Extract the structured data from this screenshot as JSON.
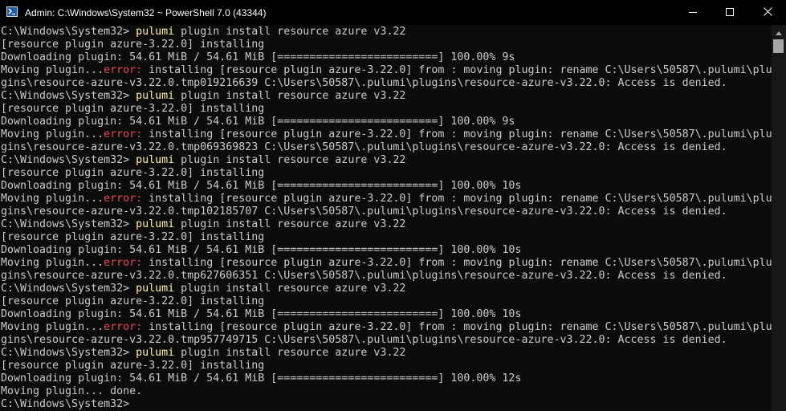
{
  "window": {
    "title": "Admin: C:\\Windows\\System32 ~ PowerShell 7.0 (43344)"
  },
  "colors": {
    "background": "#0c0c0c",
    "text": "#cccccc",
    "command": "#f9f1a5",
    "error": "#e74856"
  },
  "icons": {
    "app": "powershell-icon",
    "minimize": "minimize-icon",
    "maximize": "maximize-icon",
    "close": "close-icon",
    "scroll_up": "scroll-up-arrow-icon"
  },
  "terminal": {
    "lines": [
      [
        {
          "t": "C:\\Windows\\System32> "
        },
        {
          "t": "pulumi",
          "c": "cmd"
        },
        {
          "t": " plugin install resource azure v3.22"
        }
      ],
      [
        {
          "t": "[resource plugin azure-3.22.0] installing"
        }
      ],
      [
        {
          "t": "Downloading plugin: 54.61 MiB / 54.61 MiB [=========================] 100.00% 9s"
        }
      ],
      [
        {
          "t": "Moving plugin..."
        },
        {
          "t": "error:",
          "c": "err"
        },
        {
          "t": " installing [resource plugin azure-3.22.0] from : moving plugin: rename C:\\Users\\50587\\.pulumi\\plu"
        }
      ],
      [
        {
          "t": "gins\\resource-azure-v3.22.0.tmp019216639 C:\\Users\\50587\\.pulumi\\plugins\\resource-azure-v3.22.0: Access is denied."
        }
      ],
      [
        {
          "t": "C:\\Windows\\System32> "
        },
        {
          "t": "pulumi",
          "c": "cmd"
        },
        {
          "t": " plugin install resource azure v3.22"
        }
      ],
      [
        {
          "t": "[resource plugin azure-3.22.0] installing"
        }
      ],
      [
        {
          "t": "Downloading plugin: 54.61 MiB / 54.61 MiB [=========================] 100.00% 9s"
        }
      ],
      [
        {
          "t": "Moving plugin..."
        },
        {
          "t": "error:",
          "c": "err"
        },
        {
          "t": " installing [resource plugin azure-3.22.0] from : moving plugin: rename C:\\Users\\50587\\.pulumi\\plu"
        }
      ],
      [
        {
          "t": "gins\\resource-azure-v3.22.0.tmp069369823 C:\\Users\\50587\\.pulumi\\plugins\\resource-azure-v3.22.0: Access is denied."
        }
      ],
      [
        {
          "t": "C:\\Windows\\System32> "
        },
        {
          "t": "pulumi",
          "c": "cmd"
        },
        {
          "t": " plugin install resource azure v3.22"
        }
      ],
      [
        {
          "t": "[resource plugin azure-3.22.0] installing"
        }
      ],
      [
        {
          "t": "Downloading plugin: 54.61 MiB / 54.61 MiB [=========================] 100.00% 10s"
        }
      ],
      [
        {
          "t": "Moving plugin..."
        },
        {
          "t": "error:",
          "c": "err"
        },
        {
          "t": " installing [resource plugin azure-3.22.0] from : moving plugin: rename C:\\Users\\50587\\.pulumi\\plu"
        }
      ],
      [
        {
          "t": "gins\\resource-azure-v3.22.0.tmp102185707 C:\\Users\\50587\\.pulumi\\plugins\\resource-azure-v3.22.0: Access is denied."
        }
      ],
      [
        {
          "t": "C:\\Windows\\System32> "
        },
        {
          "t": "pulumi",
          "c": "cmd"
        },
        {
          "t": " plugin install resource azure v3.22"
        }
      ],
      [
        {
          "t": "[resource plugin azure-3.22.0] installing"
        }
      ],
      [
        {
          "t": "Downloading plugin: 54.61 MiB / 54.61 MiB [=========================] 100.00% 10s"
        }
      ],
      [
        {
          "t": "Moving plugin..."
        },
        {
          "t": "error:",
          "c": "err"
        },
        {
          "t": " installing [resource plugin azure-3.22.0] from : moving plugin: rename C:\\Users\\50587\\.pulumi\\plu"
        }
      ],
      [
        {
          "t": "gins\\resource-azure-v3.22.0.tmp627606351 C:\\Users\\50587\\.pulumi\\plugins\\resource-azure-v3.22.0: Access is denied."
        }
      ],
      [
        {
          "t": "C:\\Windows\\System32> "
        },
        {
          "t": "pulumi",
          "c": "cmd"
        },
        {
          "t": " plugin install resource azure v3.22"
        }
      ],
      [
        {
          "t": "[resource plugin azure-3.22.0] installing"
        }
      ],
      [
        {
          "t": "Downloading plugin: 54.61 MiB / 54.61 MiB [=========================] 100.00% 10s"
        }
      ],
      [
        {
          "t": "Moving plugin..."
        },
        {
          "t": "error:",
          "c": "err"
        },
        {
          "t": " installing [resource plugin azure-3.22.0] from : moving plugin: rename C:\\Users\\50587\\.pulumi\\plu"
        }
      ],
      [
        {
          "t": "gins\\resource-azure-v3.22.0.tmp957749715 C:\\Users\\50587\\.pulumi\\plugins\\resource-azure-v3.22.0: Access is denied."
        }
      ],
      [
        {
          "t": "C:\\Windows\\System32> "
        },
        {
          "t": "pulumi",
          "c": "cmd"
        },
        {
          "t": " plugin install resource azure v3.22"
        }
      ],
      [
        {
          "t": "[resource plugin azure-3.22.0] installing"
        }
      ],
      [
        {
          "t": "Downloading plugin: 54.61 MiB / 54.61 MiB [=========================] 100.00% 12s"
        }
      ],
      [
        {
          "t": "Moving plugin... done."
        }
      ],
      [
        {
          "t": "C:\\Windows\\System32> "
        }
      ]
    ]
  }
}
